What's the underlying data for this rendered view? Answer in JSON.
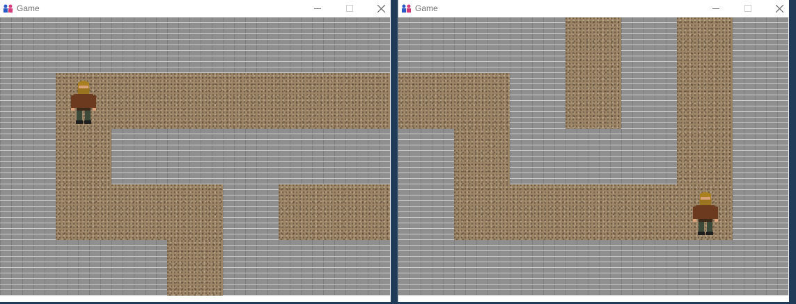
{
  "windows": [
    {
      "title": "Game",
      "controls": {
        "minimize": "minimize-icon",
        "maximize": "maximize-icon",
        "close": "close-icon"
      },
      "player": {
        "sprite": "bearded-dwarf",
        "tile": [
          1,
          1
        ]
      }
    },
    {
      "title": "Game",
      "controls": {
        "minimize": "minimize-icon",
        "maximize": "maximize-icon",
        "close": "close-icon"
      },
      "player": {
        "sprite": "bearded-dwarf",
        "tile": [
          5,
          3
        ]
      }
    }
  ],
  "colors": {
    "wall": "#8f8f8f",
    "wall_mortar": "#cfcfcf",
    "floor": "#9c8466",
    "titlebar": "#ffffff",
    "title_text": "#6e6e6e"
  }
}
